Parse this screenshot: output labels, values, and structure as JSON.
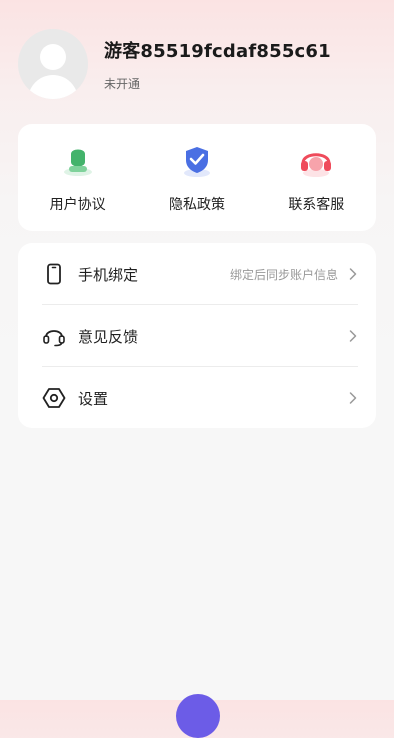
{
  "profile": {
    "username": "游客85519fcdaf855c61",
    "status": "未开通"
  },
  "quick_actions": [
    {
      "label": "用户协议",
      "icon": "user-agreement-icon",
      "color": "#43b36b"
    },
    {
      "label": "隐私政策",
      "icon": "privacy-shield-icon",
      "color": "#4a6fe3"
    },
    {
      "label": "联系客服",
      "icon": "customer-service-headset-icon",
      "color": "#ef4b5b"
    }
  ],
  "menu": [
    {
      "label": "手机绑定",
      "hint": "绑定后同步账户信息",
      "icon": "phone-icon"
    },
    {
      "label": "意见反馈",
      "hint": "",
      "icon": "headset-icon"
    },
    {
      "label": "设置",
      "hint": "",
      "icon": "settings-hexagon-icon"
    }
  ],
  "colors": {
    "accent_purple": "#6c5ce7",
    "background": "#f7f7f7",
    "header_gradient_top": "#fbe3e3"
  }
}
